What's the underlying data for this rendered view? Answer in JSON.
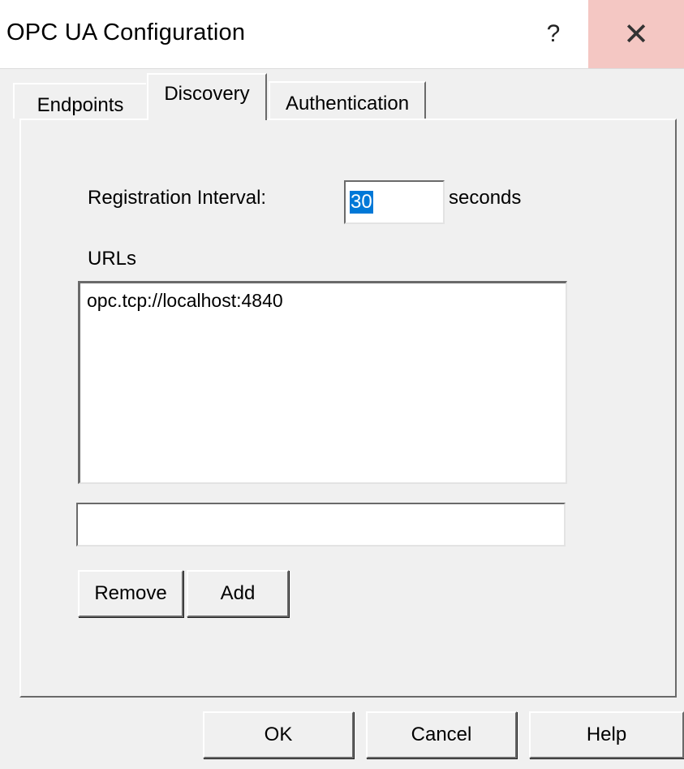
{
  "window": {
    "title": "OPC UA Configuration",
    "help_glyph": "?",
    "close_glyph": "✕",
    "close_hover_color": "#f4c7c3"
  },
  "tabs": [
    {
      "label": "Endpoints",
      "selected": false
    },
    {
      "label": "Discovery",
      "selected": true
    },
    {
      "label": "Authentication",
      "selected": false
    }
  ],
  "discovery": {
    "interval_label": "Registration Interval:",
    "interval_value": "30",
    "interval_unit": "seconds",
    "urls_label": "URLs",
    "urls": [
      "opc.tcp://localhost:4840"
    ],
    "new_url_value": "",
    "remove_label": "Remove",
    "add_label": "Add"
  },
  "footer": {
    "ok_label": "OK",
    "cancel_label": "Cancel",
    "help_label": "Help"
  },
  "colors": {
    "selection": "#0078d7",
    "face": "#f0f0f0"
  }
}
